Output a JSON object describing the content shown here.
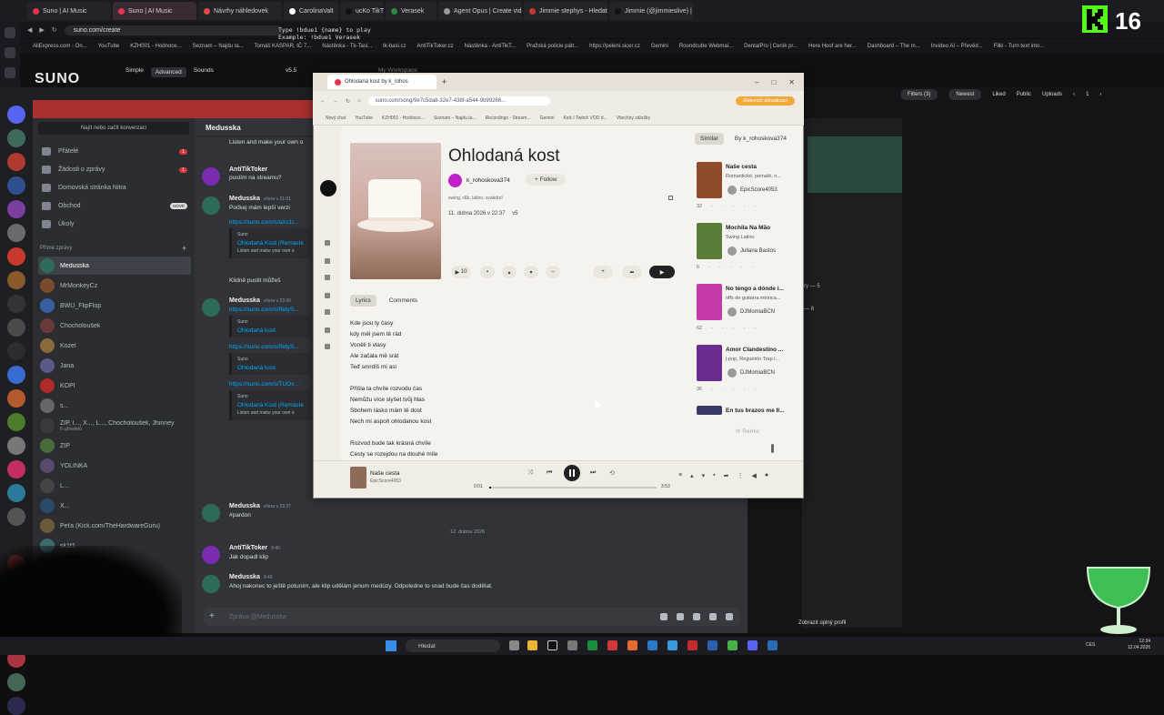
{
  "browser": {
    "tabs": [
      {
        "label": "Suno | AI Music",
        "color": "#e2344b",
        "active": false
      },
      {
        "label": "Suno | AI Music",
        "color": "#e2344b",
        "active": true
      },
      {
        "label": "Návrhy náhledovek",
        "color": "#e24a4a",
        "active": false
      },
      {
        "label": "CarolinaValt",
        "color": "#ffffff",
        "active": false
      },
      {
        "label": "ucKo TikT",
        "color": "#111111",
        "active": false
      },
      {
        "label": "Verasek",
        "color": "#2b8a3e",
        "active": false
      },
      {
        "label": "Agent Opus | Create vide",
        "color": "#9a9a9a",
        "active": false
      },
      {
        "label": "Jimmie stephys - Hledat",
        "color": "#c0392b",
        "active": false
      },
      {
        "label": "Jimmie (@jimmieslive) |",
        "color": "#111111",
        "active": false
      }
    ],
    "url": "suno.com/create",
    "bookmarks": [
      "AliExpress.com - On...",
      "YouTube",
      "KZH001 - Hodnoce...",
      "Seznam – Najdu ta...",
      "Tomáš KASPAR, IČ 7...",
      "Nástěnka - Tk-Tasi...",
      "tk-basi.cz",
      "AntiTikToker.cz",
      "Nástěnka - AntiTikT...",
      "Pražská policie pátr...",
      "https://peleni.sicer.cz",
      "Gemini",
      "Roundcube Webmai...",
      "DentalPro | Ceník pr...",
      "Here Hoof are her...",
      "Dashboard – The m...",
      "Invideo AI – Převéd...",
      "Filki - Turn text into..."
    ]
  },
  "overlay": {
    "type_hint_line1": "Type !bdue1 {name} to play",
    "type_hint_line2": "Example: !bdue1 Verasek",
    "channel_number": "16"
  },
  "suno": {
    "logo": "SUNO",
    "modes": [
      "Simple",
      "Advanced",
      "Sounds"
    ],
    "version": "v5.5",
    "breadcrumb": "My Workspace",
    "controls": {
      "filters": "Filters (3)",
      "sort": "Newest",
      "liked": "Liked",
      "public": "Public",
      "uploads": "Uploads",
      "page": "1"
    },
    "row1": "ry — 5",
    "row2": "— 8",
    "show_profile": "Zobrazit úplný profil"
  },
  "discord": {
    "search_placeholder": "Najít nebo začít konverzaci",
    "nav": [
      {
        "label": "Přátelé",
        "badge": "1"
      },
      {
        "label": "Žádosti o zprávy",
        "badge": "1"
      },
      {
        "label": "Domovská stránka Nitra",
        "badge": ""
      },
      {
        "label": "Obchod",
        "badge": "NOVÉ"
      },
      {
        "label": "Úkoly",
        "badge": ""
      }
    ],
    "dm_header": "Přímé zprávy",
    "dms": [
      "Medusska",
      "MrMonkeyCz",
      "BWU_FlipFlop",
      "Chocholoušek",
      "Kozel",
      "Jana",
      "KOPI",
      "s...",
      "ZIP, l..., X..., L..., Chocholoušek, Jhinney",
      "ZIP",
      "YOLINKA",
      "L...",
      "X...",
      "Peťa (Kick.com/TheHardwareGuru)",
      "sk1f1",
      "PavlaPavli"
    ],
    "dm_subtitle": "6 uživatelů",
    "channel_title": "Medusska",
    "messages": [
      {
        "name": "",
        "time": "",
        "text": "Listen and make your own o"
      },
      {
        "name": "AntiTikToker",
        "time": "",
        "text": "pustím na streamu?"
      },
      {
        "name": "Medusska",
        "time": "včera v 21:01",
        "text": "Počkej mám lepší verzi"
      },
      {
        "name": "",
        "time": "",
        "text": "https://suno.com/s/aXc1l..."
      },
      {
        "name": "",
        "time": "",
        "text": "Klidně pustit můžeš"
      },
      {
        "name": "Medusska",
        "time": "včera v 23:00",
        "text": "https://suno.com/s/f6dyS..."
      },
      {
        "name": "Medusska",
        "time": "včera v 23:27",
        "text": "#pardon"
      },
      {
        "name": "AntiTikToker",
        "time": "9:40",
        "text": "Jak dopadl klip"
      },
      {
        "name": "Medusska",
        "time": "9:43",
        "text": "Ahoj nakonec to ještě potuním, ale klip udělám jenom medúzy. Odpoledne to snad bude čas dodělat."
      }
    ],
    "embed_site": "Suno",
    "embed_title_a": "Ohlodaná Kost (Remaste",
    "embed_title_b": "Ohlodaná kost",
    "link_b": "https://suno.com/s/f6dyS...",
    "link_c": "https://suno.com/s/TUOx...",
    "embed_title_c": "Ohlodaná Kost (Remaste",
    "date_separator": "12. dubna 2026",
    "composer_placeholder": "Zpráva @Medusska"
  },
  "popup": {
    "tab_title": "Ohlodaná kost by k_rohos",
    "url": "suno.com/song/9e7c5da8-32e7-438f-a544-9b99266...",
    "update_label": "Dokončit aktualizaci",
    "bookmarks": [
      "Nový chat",
      "YouTube",
      "KZH001 - Hodnoce...",
      "Seznam – Najdu ta...",
      "Recordings - Stream...",
      "Gemini",
      "Kick / Twitch VOD d...",
      "Všechny záložky"
    ],
    "song": {
      "title": "Ohlodaná kost",
      "artist": "k_rohoskova374",
      "follow": "Follow",
      "genre": "swing, r&b, latino, svatební",
      "date": "11. dubna 2026 v 22:37",
      "version": "v5",
      "plays": "10"
    },
    "lyric_tabs": [
      "Lyrics",
      "Comments"
    ],
    "lyrics": [
      [
        "Kde jsou ty časy",
        "kdy měl jsem tě rád",
        "Voněli ti vlasy",
        "Ale začala mě srát",
        "Teď smrdíš mi asi"
      ],
      [
        "Přišla ta chvíle rozvodu čas",
        "Nemůžu více slyšet tvůj hlas",
        "Sbohem lásko mám tě dost",
        "Nech mi aspoň ohlodanou kost"
      ],
      [
        "Rozvod bude tak krásná chvíle",
        "Cesty se rozejdou na dlouhé míle"
      ]
    ],
    "similar_tabs": [
      "Similar",
      "By k_rohoskova374"
    ],
    "similar": [
      {
        "title": "Naše cesta",
        "desc": "Romantické, pomalé, n...",
        "artist": "EpicScore4053",
        "plays": "32",
        "color": "#8e4a2b"
      },
      {
        "title": "Mochila Na Mão",
        "desc": "Swing Latino",
        "artist": "Juliana Bastos",
        "plays": "6",
        "color": "#5a7d3a"
      },
      {
        "title": "No tengo a dónde i...",
        "desc": "riffs de guitarra intrinca...",
        "artist": "DJMomiaBCN",
        "plays": "62",
        "color": "#c43aa7"
      },
      {
        "title": "Amor Clandestino ...",
        "desc": "j-pop, Reguetón Trap l...",
        "artist": "DJMomiaBCN",
        "plays": "36",
        "color": "#6a2d8f"
      },
      {
        "title": "En tus brazos me II...",
        "desc": "",
        "artist": "",
        "plays": "",
        "color": "#3a3a6a"
      }
    ],
    "remix": "Remix",
    "player": {
      "title": "Naše cesta",
      "artist": "EpicScore4053",
      "current": "0:01",
      "duration": "3:53",
      "progress": 0.01
    }
  },
  "taskbar": {
    "search": "Hledat",
    "lang": "CES",
    "time": "12:34",
    "date": "12.04.2026"
  }
}
